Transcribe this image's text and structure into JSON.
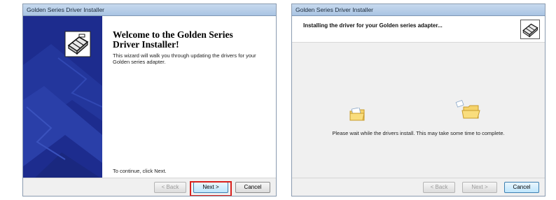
{
  "left_window": {
    "title": "Golden Series Driver Installer",
    "heading": "Welcome to the Golden Series Driver Installer!",
    "description": "This wizard will walk you through updating the drivers for your Golden series adapter.",
    "continue_text": "To continue, click Next.",
    "buttons": {
      "back": "< Back",
      "next": "Next >",
      "cancel": "Cancel"
    },
    "highlight_color": "#d9211d"
  },
  "right_window": {
    "title": "Golden Series Driver Installer",
    "header_text": "Installing the driver for your Golden series adapter...",
    "status_text": "Please wait while the drivers install. This may take some time to complete.",
    "buttons": {
      "back": "< Back",
      "next": "Next >",
      "cancel": "Cancel"
    }
  },
  "icons": [
    "installer-box-icon",
    "folder-icon",
    "folder-open-icon"
  ],
  "colors": {
    "banner_blue": "#1d2c8e",
    "title_bar": "#b7cfea",
    "default_button_border": "#3c7fb1"
  }
}
